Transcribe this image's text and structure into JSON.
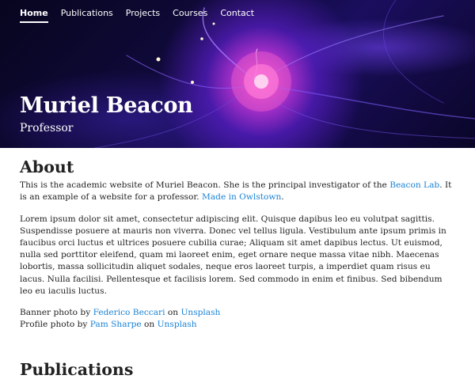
{
  "nav": {
    "items": [
      {
        "label": "Home"
      },
      {
        "label": "Publications"
      },
      {
        "label": "Projects"
      },
      {
        "label": "Courses"
      },
      {
        "label": "Contact"
      }
    ]
  },
  "hero": {
    "title": "Muriel Beacon",
    "subtitle": "Professor"
  },
  "about": {
    "heading": "About",
    "intro_before": "This is the academic website of Muriel Beacon. She is the principal investigator of the ",
    "lab_link": "Beacon Lab",
    "intro_middle": ". It is an example of a website for a professor. ",
    "made_link": "Made in Owlstown",
    "intro_after": ".",
    "lorem": "Lorem ipsum dolor sit amet, consectetur adipiscing elit. Quisque dapibus leo eu volutpat sagittis. Suspendisse posuere at mauris non viverra. Donec vel tellus ligula. Vestibulum ante ipsum primis in faucibus orci luctus et ultrices posuere cubilia curae; Aliquam sit amet dapibus lectus. Ut euismod, nulla sed porttitor eleifend, quam mi laoreet enim, eget ornare neque massa vitae nibh. Maecenas lobortis, massa sollicitudin aliquet sodales, neque eros laoreet turpis, a imperdiet quam risus eu lacus. Nulla facilisi. Pellentesque et facilisis lorem. Sed commodo in enim et finibus. Sed bibendum leo eu iaculis luctus.",
    "credit1_prefix": "Banner photo by ",
    "credit1_author": "Federico Beccari",
    "credit_on": " on ",
    "credit1_site": "Unsplash",
    "credit2_prefix": "Profile photo by ",
    "credit2_author": "Pam Sharpe",
    "credit2_site": "Unsplash"
  },
  "publications": {
    "heading": "Publications"
  },
  "colors": {
    "link": "#1a82d6",
    "hero_bg": "#100a3c",
    "plasma": "#ff66cc"
  }
}
